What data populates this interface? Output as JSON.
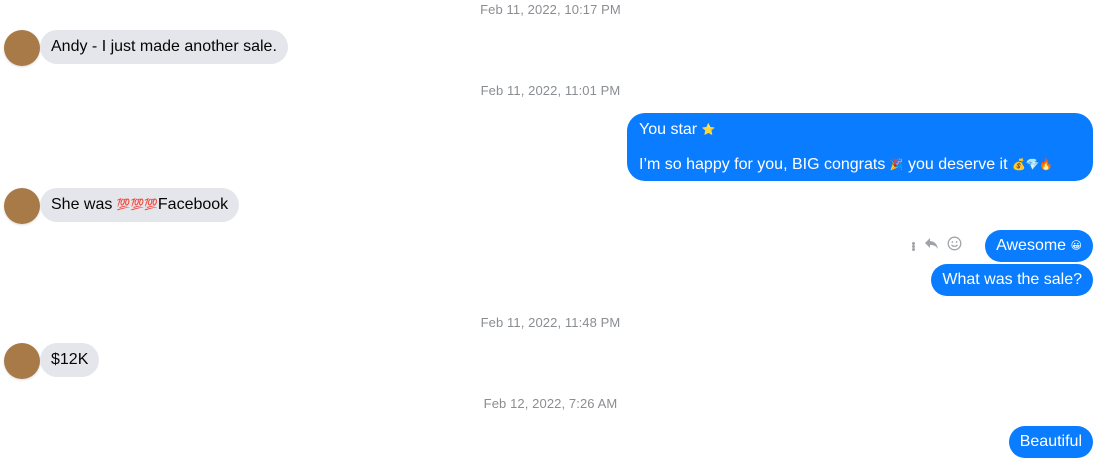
{
  "conversation": {
    "timestamps": [
      "Feb 11, 2022, 10:17 PM",
      "Feb 11, 2022, 11:01 PM",
      "Feb 11, 2022, 11:48 PM",
      "Feb 12, 2022, 7:26 AM"
    ],
    "messages": {
      "m1": "Andy - I just made another sale.",
      "m2_line1": "You star",
      "m2_line1_emoji": "⭐",
      "m2_line2_a": "I’m so happy for you, BIG congrats",
      "m2_line2_emoji1": "🎉",
      "m2_line2_b": " you deserve it",
      "m2_line2_emoji2": "💰💎🔥",
      "m3_a": "She was ",
      "m3_emoji": "💯💯💯",
      "m3_b": "Facebook",
      "m4": "Awesome",
      "m4_emoji": "😀",
      "m5": "What was the sale?",
      "m6": "$12K",
      "m7": "Beautiful"
    },
    "message_actions": {
      "more_icon": "more-vertical-icon",
      "reply_icon": "reply-icon",
      "react_icon": "smiley-icon"
    },
    "colors": {
      "incoming_bubble": "#e4e6eb",
      "outgoing_bubble": "#0a7cff",
      "avatar": "#a77a47",
      "timestamp": "#8a8d91"
    }
  }
}
